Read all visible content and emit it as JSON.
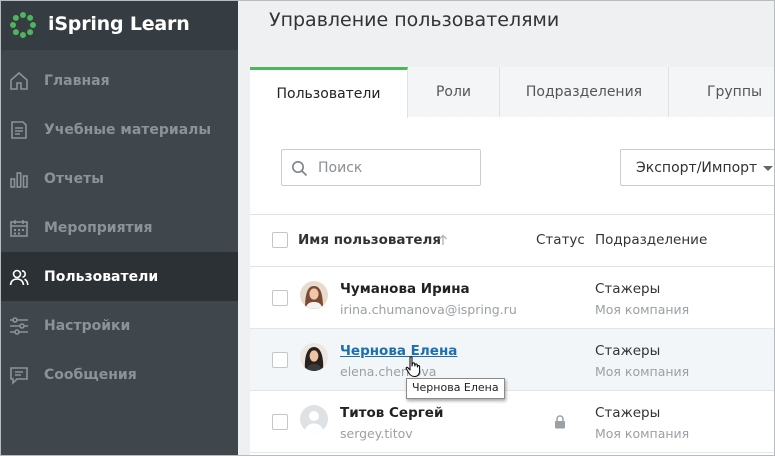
{
  "app": {
    "logo_text": "iSpring Learn",
    "accent_color": "#4db55c"
  },
  "sidebar": {
    "items": [
      {
        "label": "Главная",
        "icon": "home-icon",
        "active": false
      },
      {
        "label": "Учебные материалы",
        "icon": "learning-materials-icon",
        "active": false
      },
      {
        "label": "Отчеты",
        "icon": "reports-icon",
        "active": false
      },
      {
        "label": "Мероприятия",
        "icon": "calendar-icon",
        "active": false
      },
      {
        "label": "Пользователи",
        "icon": "users-icon",
        "active": true
      },
      {
        "label": "Настройки",
        "icon": "settings-sliders-icon",
        "active": false
      },
      {
        "label": "Сообщения",
        "icon": "messages-icon",
        "active": false
      }
    ]
  },
  "page": {
    "title": "Управление пользователями"
  },
  "tabs": [
    {
      "label": "Пользователи",
      "active": true
    },
    {
      "label": "Роли",
      "active": false
    },
    {
      "label": "Подразделения",
      "active": false
    },
    {
      "label": "Группы",
      "active": false
    }
  ],
  "toolbar": {
    "search_placeholder": "Поиск",
    "search_value": "",
    "export_label": "Экспорт/Импорт"
  },
  "table": {
    "columns": {
      "name": "Имя пользователя",
      "status": "Статус",
      "department": "Подразделение"
    },
    "rows": [
      {
        "name": "Чуманова Ирина",
        "email": "irina.chumanova@ispring.ru",
        "status": "",
        "department": "Стажеры",
        "company": "Моя компания",
        "avatar": "photo-avatar"
      },
      {
        "name": "Чернова Елена",
        "email": "elena.chernova",
        "status": "",
        "department": "Стажеры",
        "company": "Моя компания",
        "avatar": "photo-avatar"
      },
      {
        "name": "Титов Сергей",
        "email": "sergey.titov",
        "status": "locked",
        "department": "Стажеры",
        "company": "Моя компания",
        "avatar": "placeholder-avatar"
      }
    ]
  },
  "tooltip": {
    "text": "Чернова Елена"
  }
}
